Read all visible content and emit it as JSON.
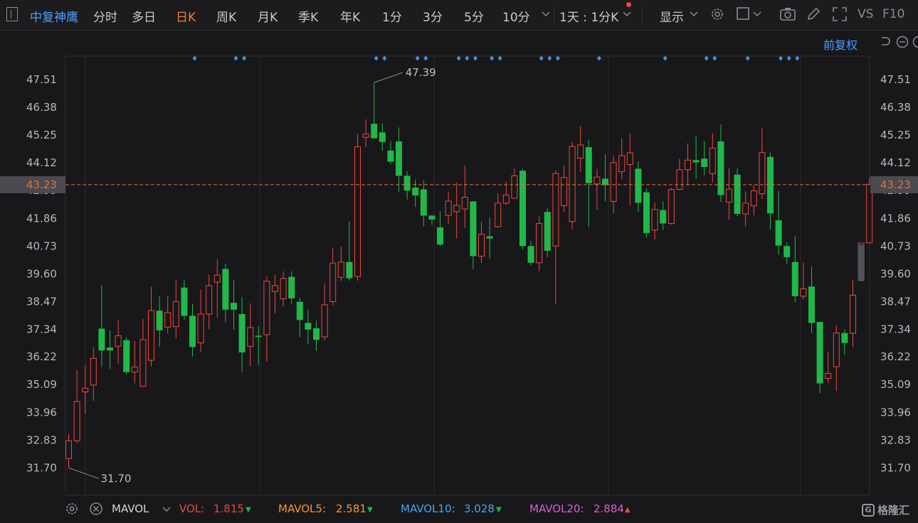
{
  "toolbar": {
    "stock_name": "中复神鹰",
    "tabs": [
      "分时",
      "多日",
      "日K",
      "周K",
      "月K",
      "季K",
      "年K",
      "1分",
      "3分",
      "5分",
      "10分"
    ],
    "active_tab": "日K",
    "period_select": "1天 : 1分K",
    "display_label": "显示",
    "vs_label": "VS",
    "f10_label": "F10"
  },
  "adjust_label": "前复权",
  "colors": {
    "up": "#f0473a",
    "down": "#21b84a",
    "price_line": "#e8703a",
    "markers": "#4a90e2",
    "bg": "#18181b"
  },
  "chart_data": {
    "type": "candlestick",
    "title": "",
    "y_ticks": [
      "47.51",
      "46.38",
      "45.25",
      "44.12",
      "42.99",
      "41.86",
      "40.73",
      "39.60",
      "38.47",
      "37.34",
      "36.22",
      "35.09",
      "33.96",
      "32.83",
      "31.70"
    ],
    "ylim": [
      31.18,
      48.4
    ],
    "current_price": "43.23",
    "max_label": "47.39",
    "min_label": "31.70",
    "candles": [
      {
        "o": 32.08,
        "c": 32.8,
        "h": 33.08,
        "l": 31.7
      },
      {
        "o": 32.8,
        "c": 34.4,
        "h": 35.68,
        "l": 32.71
      },
      {
        "o": 34.79,
        "c": 34.94,
        "h": 35.88,
        "l": 33.9
      },
      {
        "o": 35.07,
        "c": 36.16,
        "h": 36.61,
        "l": 34.43
      },
      {
        "o": 37.37,
        "c": 36.48,
        "h": 39.14,
        "l": 35.8
      },
      {
        "o": 36.6,
        "c": 36.48,
        "h": 37.3,
        "l": 35.73
      },
      {
        "o": 36.65,
        "c": 37.08,
        "h": 37.71,
        "l": 35.95
      },
      {
        "o": 36.9,
        "c": 35.6,
        "h": 37.0,
        "l": 35.5
      },
      {
        "o": 35.6,
        "c": 35.8,
        "h": 36.86,
        "l": 35.14
      },
      {
        "o": 35.02,
        "c": 36.92,
        "h": 37.76,
        "l": 35.02
      },
      {
        "o": 36.08,
        "c": 38.1,
        "h": 39.08,
        "l": 35.83
      },
      {
        "o": 38.1,
        "c": 37.3,
        "h": 38.68,
        "l": 36.62
      },
      {
        "o": 37.43,
        "c": 38.02,
        "h": 38.7,
        "l": 37.16
      },
      {
        "o": 37.45,
        "c": 38.47,
        "h": 39.35,
        "l": 36.96
      },
      {
        "o": 39.04,
        "c": 37.89,
        "h": 39.34,
        "l": 37.73
      },
      {
        "o": 37.89,
        "c": 36.62,
        "h": 38.38,
        "l": 36.23
      },
      {
        "o": 36.79,
        "c": 37.96,
        "h": 38.95,
        "l": 36.42
      },
      {
        "o": 37.96,
        "c": 39.12,
        "h": 39.56,
        "l": 37.34
      },
      {
        "o": 39.26,
        "c": 39.55,
        "h": 40.19,
        "l": 37.82
      },
      {
        "o": 39.8,
        "c": 38.14,
        "h": 40.0,
        "l": 37.62
      },
      {
        "o": 38.42,
        "c": 38.14,
        "h": 39.33,
        "l": 37.32
      },
      {
        "o": 37.96,
        "c": 36.4,
        "h": 38.66,
        "l": 35.6
      },
      {
        "o": 36.64,
        "c": 37.41,
        "h": 38.4,
        "l": 35.84
      },
      {
        "o": 37.08,
        "c": 37.03,
        "h": 37.46,
        "l": 35.9
      },
      {
        "o": 37.12,
        "c": 39.3,
        "h": 39.5,
        "l": 36.04
      },
      {
        "o": 38.88,
        "c": 39.12,
        "h": 39.56,
        "l": 38.0
      },
      {
        "o": 38.58,
        "c": 39.41,
        "h": 39.7,
        "l": 38.28
      },
      {
        "o": 39.48,
        "c": 38.6,
        "h": 39.7,
        "l": 38.38
      },
      {
        "o": 38.46,
        "c": 37.72,
        "h": 38.62,
        "l": 37.02
      },
      {
        "o": 37.6,
        "c": 37.33,
        "h": 38.13,
        "l": 36.76
      },
      {
        "o": 37.38,
        "c": 36.91,
        "h": 37.69,
        "l": 36.46
      },
      {
        "o": 37.03,
        "c": 38.34,
        "h": 39.21,
        "l": 36.9
      },
      {
        "o": 38.47,
        "c": 40.04,
        "h": 40.64,
        "l": 38.32
      },
      {
        "o": 39.46,
        "c": 40.08,
        "h": 40.7,
        "l": 39.31
      },
      {
        "o": 40.08,
        "c": 39.42,
        "h": 41.74,
        "l": 39.32
      },
      {
        "o": 39.49,
        "c": 44.77,
        "h": 45.29,
        "l": 39.32
      },
      {
        "o": 45.16,
        "c": 45.29,
        "h": 45.89,
        "l": 44.75
      },
      {
        "o": 45.71,
        "c": 45.12,
        "h": 47.39,
        "l": 45.12
      },
      {
        "o": 45.36,
        "c": 44.97,
        "h": 45.73,
        "l": 44.62
      },
      {
        "o": 44.62,
        "c": 44.17,
        "h": 45.0,
        "l": 44.06
      },
      {
        "o": 44.99,
        "c": 43.59,
        "h": 45.56,
        "l": 42.93
      },
      {
        "o": 43.59,
        "c": 42.99,
        "h": 43.78,
        "l": 42.63
      },
      {
        "o": 43.11,
        "c": 42.79,
        "h": 43.44,
        "l": 42.32
      },
      {
        "o": 43.04,
        "c": 41.97,
        "h": 43.41,
        "l": 41.53
      },
      {
        "o": 41.97,
        "c": 41.81,
        "h": 42.01,
        "l": 41.59
      },
      {
        "o": 41.49,
        "c": 40.79,
        "h": 42.15,
        "l": 40.72
      },
      {
        "o": 41.98,
        "c": 42.56,
        "h": 42.92,
        "l": 41.64
      },
      {
        "o": 42.13,
        "c": 42.39,
        "h": 43.32,
        "l": 41.05
      },
      {
        "o": 42.24,
        "c": 42.72,
        "h": 44.0,
        "l": 41.46
      },
      {
        "o": 42.55,
        "c": 40.32,
        "h": 42.56,
        "l": 39.8
      },
      {
        "o": 40.32,
        "c": 41.21,
        "h": 41.71,
        "l": 40.05
      },
      {
        "o": 41.13,
        "c": 41.04,
        "h": 41.88,
        "l": 40.22
      },
      {
        "o": 41.52,
        "c": 42.48,
        "h": 42.87,
        "l": 41.48
      },
      {
        "o": 42.48,
        "c": 42.81,
        "h": 43.34,
        "l": 42.39
      },
      {
        "o": 42.68,
        "c": 43.59,
        "h": 43.89,
        "l": 42.67
      },
      {
        "o": 43.8,
        "c": 40.73,
        "h": 43.88,
        "l": 40.61
      },
      {
        "o": 40.73,
        "c": 40.05,
        "h": 40.92,
        "l": 39.94
      },
      {
        "o": 40.05,
        "c": 41.65,
        "h": 41.96,
        "l": 39.71
      },
      {
        "o": 42.12,
        "c": 40.54,
        "h": 42.26,
        "l": 40.27
      },
      {
        "o": 40.73,
        "c": 43.69,
        "h": 43.82,
        "l": 38.37
      },
      {
        "o": 42.38,
        "c": 43.52,
        "h": 44.02,
        "l": 42.12
      },
      {
        "o": 41.73,
        "c": 44.79,
        "h": 44.96,
        "l": 41.43
      },
      {
        "o": 44.31,
        "c": 44.85,
        "h": 45.61,
        "l": 43.75
      },
      {
        "o": 44.76,
        "c": 43.29,
        "h": 45.06,
        "l": 41.5
      },
      {
        "o": 43.26,
        "c": 43.54,
        "h": 43.88,
        "l": 42.21
      },
      {
        "o": 43.47,
        "c": 43.21,
        "h": 44.46,
        "l": 42.56
      },
      {
        "o": 42.55,
        "c": 44.13,
        "h": 44.42,
        "l": 42.06
      },
      {
        "o": 43.76,
        "c": 44.41,
        "h": 45.12,
        "l": 43.45
      },
      {
        "o": 44.05,
        "c": 44.53,
        "h": 45.32,
        "l": 42.37
      },
      {
        "o": 43.88,
        "c": 42.49,
        "h": 44.17,
        "l": 42.12
      },
      {
        "o": 42.92,
        "c": 41.26,
        "h": 43.06,
        "l": 41.06
      },
      {
        "o": 41.38,
        "c": 42.22,
        "h": 42.49,
        "l": 41.0
      },
      {
        "o": 42.2,
        "c": 41.65,
        "h": 42.54,
        "l": 41.38
      },
      {
        "o": 41.65,
        "c": 43.03,
        "h": 43.09,
        "l": 41.6
      },
      {
        "o": 43.04,
        "c": 43.84,
        "h": 44.28,
        "l": 43.0
      },
      {
        "o": 43.84,
        "c": 44.23,
        "h": 44.91,
        "l": 43.2
      },
      {
        "o": 44.23,
        "c": 44.14,
        "h": 45.23,
        "l": 43.47
      },
      {
        "o": 44.29,
        "c": 43.95,
        "h": 45.01,
        "l": 43.61
      },
      {
        "o": 43.68,
        "c": 44.72,
        "h": 45.32,
        "l": 43.33
      },
      {
        "o": 44.99,
        "c": 42.81,
        "h": 45.68,
        "l": 42.52
      },
      {
        "o": 42.52,
        "c": 43.05,
        "h": 43.91,
        "l": 41.81
      },
      {
        "o": 43.64,
        "c": 42.04,
        "h": 43.89,
        "l": 41.94
      },
      {
        "o": 42.04,
        "c": 42.48,
        "h": 42.96,
        "l": 41.53
      },
      {
        "o": 42.37,
        "c": 42.98,
        "h": 43.2,
        "l": 41.98
      },
      {
        "o": 42.86,
        "c": 44.54,
        "h": 45.56,
        "l": 42.65
      },
      {
        "o": 44.36,
        "c": 42.06,
        "h": 44.54,
        "l": 41.41
      },
      {
        "o": 41.78,
        "c": 40.75,
        "h": 42.97,
        "l": 40.37
      },
      {
        "o": 40.73,
        "c": 40.28,
        "h": 40.88,
        "l": 39.99
      },
      {
        "o": 40.08,
        "c": 38.69,
        "h": 41.15,
        "l": 38.44
      },
      {
        "o": 38.69,
        "c": 38.99,
        "h": 40.07,
        "l": 38.55
      },
      {
        "o": 39.08,
        "c": 37.6,
        "h": 39.89,
        "l": 37.2
      },
      {
        "o": 37.64,
        "c": 35.14,
        "h": 37.64,
        "l": 34.74
      },
      {
        "o": 35.34,
        "c": 35.54,
        "h": 36.43,
        "l": 35.16
      },
      {
        "o": 35.82,
        "c": 37.19,
        "h": 37.52,
        "l": 34.83
      },
      {
        "o": 37.19,
        "c": 36.78,
        "h": 37.34,
        "l": 36.29
      },
      {
        "o": 37.18,
        "c": 38.73,
        "h": 39.36,
        "l": 36.62
      },
      {
        "o": 39.4,
        "c": 40.85,
        "h": 40.85,
        "l": 39.4
      },
      {
        "o": 40.86,
        "c": 43.25,
        "h": 43.52,
        "l": 40.86
      }
    ],
    "marker_slots": [
      15,
      20,
      21,
      37,
      38,
      42,
      43,
      47,
      48,
      49,
      51,
      52,
      57,
      58,
      59,
      64,
      72,
      77,
      78,
      82,
      86,
      87,
      88
    ]
  },
  "footer": {
    "indicator": "MAVOL",
    "vol_label": "VOL:",
    "vol_value": "1.815",
    "mavol5_label": "MAVOL5:",
    "mavol5_value": "2.581",
    "mavol10_label": "MAVOL10:",
    "mavol10_value": "3.028",
    "mavol20_label": "MAVOL20:",
    "mavol20_value": "2.884",
    "logo_text": "格隆汇",
    "vol_color": "#f0473a",
    "mavol5_color": "#f59a23",
    "mavol10_color": "#3fa9f5",
    "mavol20_color": "#e35ad2"
  }
}
